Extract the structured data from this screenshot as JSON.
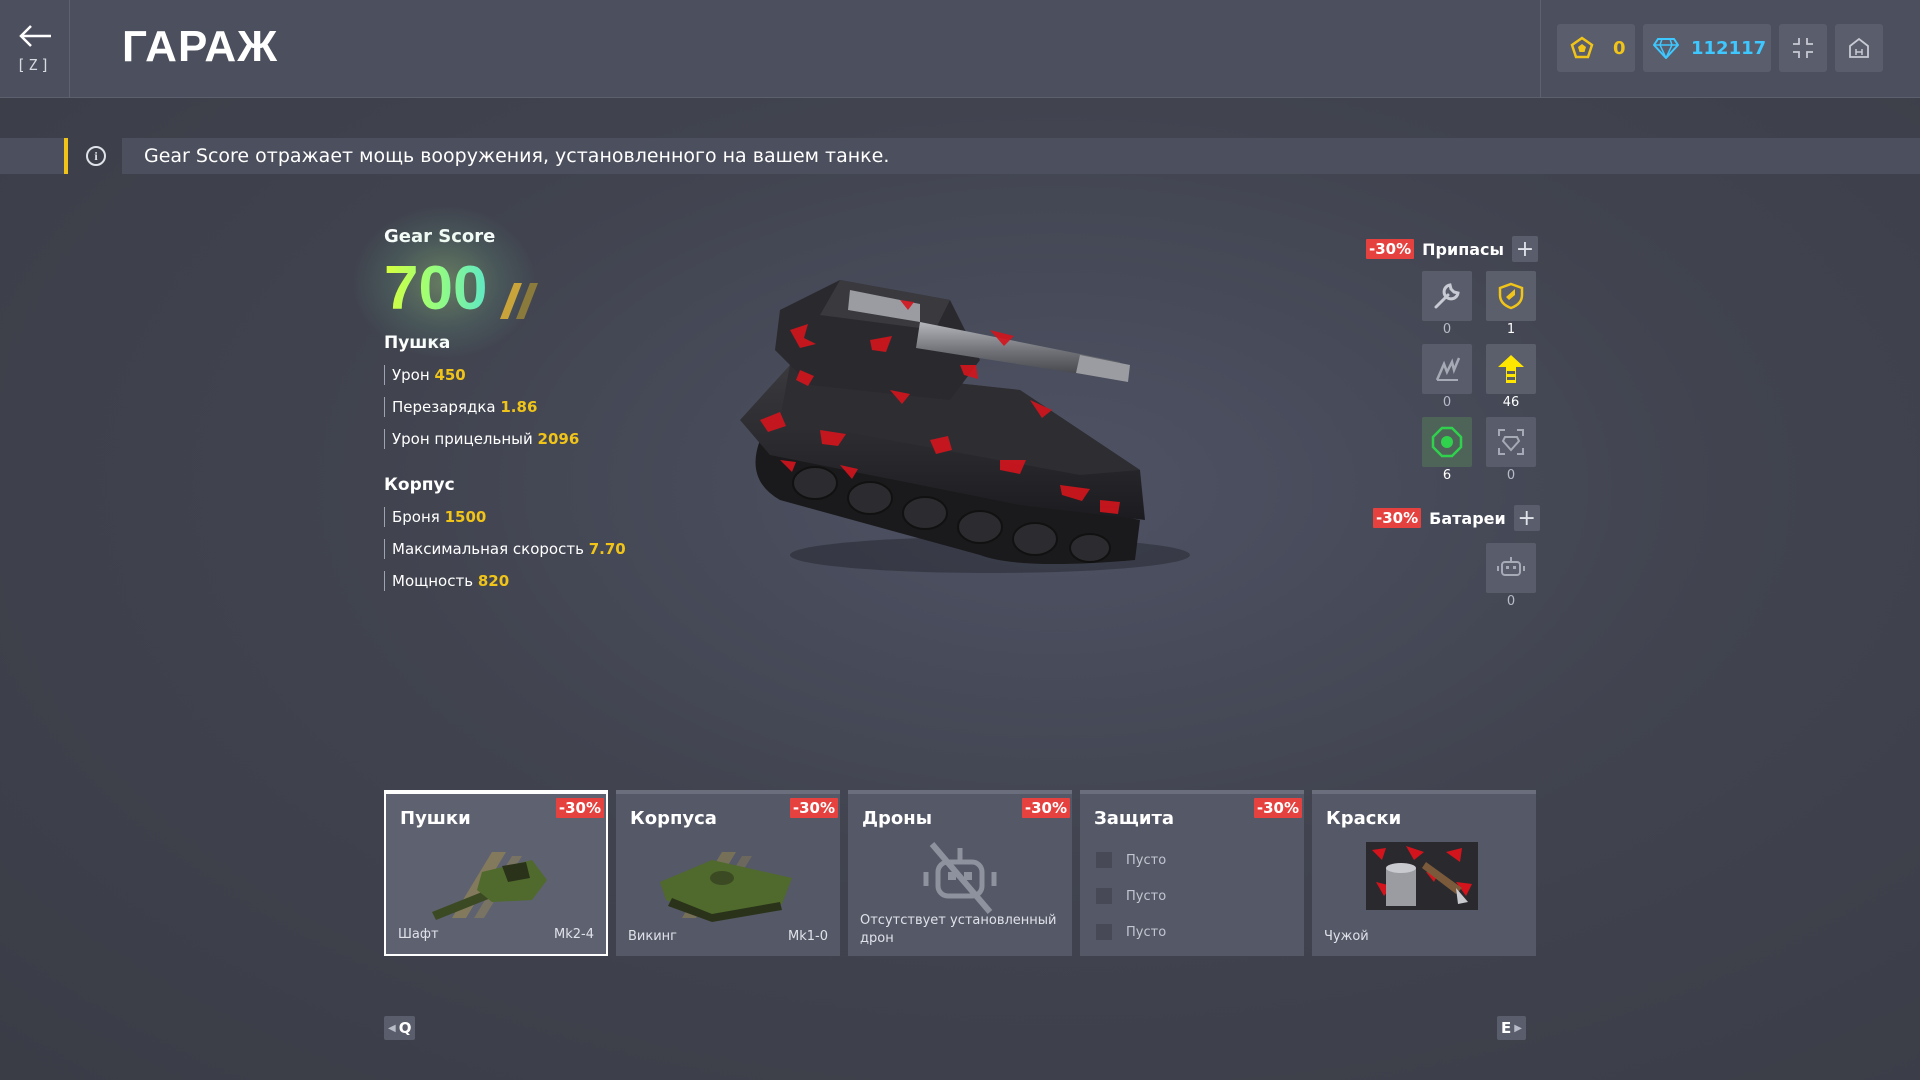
{
  "header": {
    "back_key": "[Z]",
    "title": "ГАРАЖ",
    "crystals": "0",
    "rubies": "112117"
  },
  "info": {
    "text": "Gear Score отражает мощь вооружения, установленного на вашем танке."
  },
  "gear_score": {
    "label": "Gear Score",
    "value": "700"
  },
  "turret": {
    "title": "Пушка",
    "stats": [
      {
        "label": "Урон",
        "value": "450"
      },
      {
        "label": "Перезарядка",
        "value": "1.86"
      },
      {
        "label": "Урон прицельный",
        "value": "2096"
      }
    ]
  },
  "hull": {
    "title": "Корпус",
    "stats": [
      {
        "label": "Броня",
        "value": "1500"
      },
      {
        "label": "Максимальная скорость",
        "value": "7.70"
      },
      {
        "label": "Мощность",
        "value": "820"
      }
    ]
  },
  "supplies": {
    "sale": "-30%",
    "title": "Припасы",
    "add": "+",
    "items": [
      {
        "icon": "wrench-icon",
        "count": "0"
      },
      {
        "icon": "shield-icon",
        "count": "1"
      },
      {
        "icon": "damage-boost-icon",
        "count": "0"
      },
      {
        "icon": "speed-boost-icon",
        "count": "46"
      },
      {
        "icon": "mine-icon",
        "count": "6"
      },
      {
        "icon": "gold-box-icon",
        "count": "0"
      }
    ]
  },
  "batteries": {
    "sale": "-30%",
    "title": "Батареи",
    "add": "+",
    "count": "0"
  },
  "cards": {
    "turrets": {
      "title": "Пушки",
      "sale": "-30%",
      "name": "Шафт",
      "mk": "Mk2-4"
    },
    "hulls": {
      "title": "Корпуса",
      "sale": "-30%",
      "name": "Викинг",
      "mk": "Mk1-0"
    },
    "drones": {
      "title": "Дроны",
      "sale": "-30%",
      "empty": "Отсутствует установленный дрон"
    },
    "protection": {
      "title": "Защита",
      "sale": "-30%",
      "slots": [
        "Пусто",
        "Пусто",
        "Пусто"
      ]
    },
    "paints": {
      "title": "Краски",
      "name": "Чужой"
    }
  },
  "nav": {
    "prev_key": "Q",
    "next_key": "E"
  },
  "colors": {
    "accent_yellow": "#f0c419",
    "ruby_blue": "#3ec8ff",
    "sale_red": "#e5413f",
    "gear_green": "#9cff78"
  }
}
